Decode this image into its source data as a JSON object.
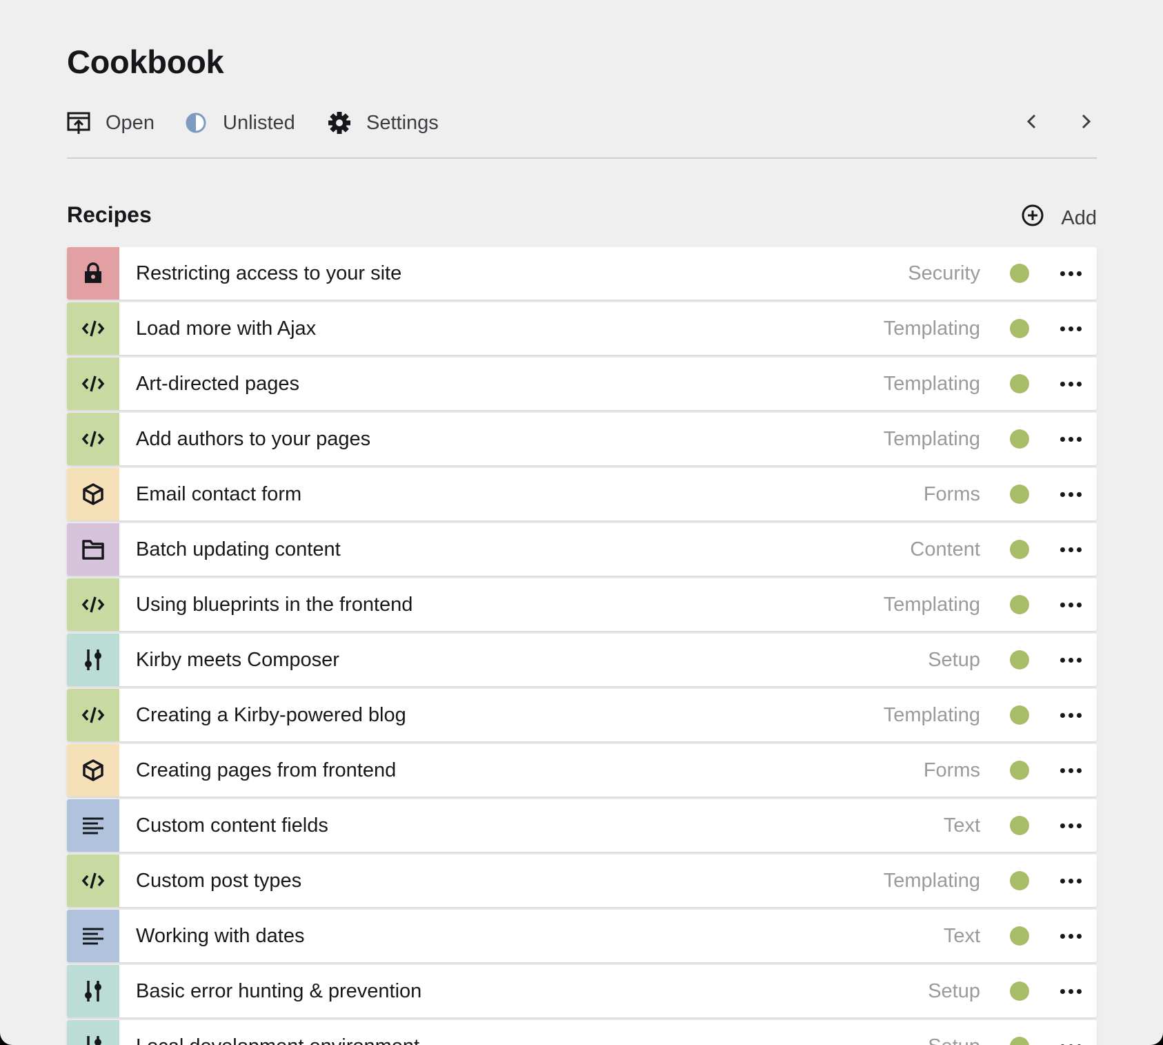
{
  "page": {
    "title": "Cookbook"
  },
  "header": {
    "open_label": "Open",
    "status_label": "Unlisted",
    "settings_label": "Settings"
  },
  "section": {
    "title": "Recipes",
    "add_label": "Add"
  },
  "colors": {
    "security": "#e3a0a3",
    "templating": "#c8d9a2",
    "forms": "#f5e0b8",
    "content": "#d7c3dc",
    "setup": "#bcdcd6",
    "text": "#b0c2dc",
    "status_listed": "#a7bd68"
  },
  "recipes": [
    {
      "title": "Restricting access to your site",
      "category": "Security",
      "icon": "lock-icon"
    },
    {
      "title": "Load more with Ajax",
      "category": "Templating",
      "icon": "code-icon"
    },
    {
      "title": "Art-directed pages",
      "category": "Templating",
      "icon": "code-icon"
    },
    {
      "title": "Add authors to your pages",
      "category": "Templating",
      "icon": "code-icon"
    },
    {
      "title": "Email contact form",
      "category": "Forms",
      "icon": "box-icon"
    },
    {
      "title": "Batch updating content",
      "category": "Content",
      "icon": "folder-icon"
    },
    {
      "title": "Using blueprints in the frontend",
      "category": "Templating",
      "icon": "code-icon"
    },
    {
      "title": "Kirby meets Composer",
      "category": "Setup",
      "icon": "sliders-icon"
    },
    {
      "title": "Creating a Kirby-powered blog",
      "category": "Templating",
      "icon": "code-icon"
    },
    {
      "title": "Creating pages from frontend",
      "category": "Forms",
      "icon": "box-icon"
    },
    {
      "title": "Custom content fields",
      "category": "Text",
      "icon": "text-lines-icon"
    },
    {
      "title": "Custom post types",
      "category": "Templating",
      "icon": "code-icon"
    },
    {
      "title": "Working with dates",
      "category": "Text",
      "icon": "text-lines-icon"
    },
    {
      "title": "Basic error hunting & prevention",
      "category": "Setup",
      "icon": "sliders-icon"
    },
    {
      "title": "Local development environment",
      "category": "Setup",
      "icon": "sliders-icon"
    }
  ]
}
